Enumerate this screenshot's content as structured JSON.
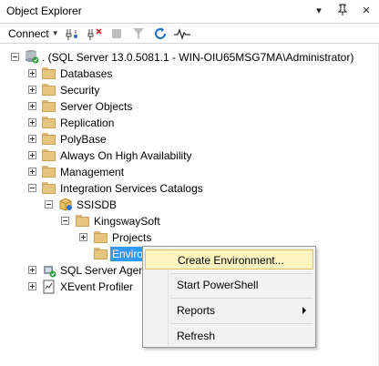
{
  "window": {
    "title": "Object Explorer"
  },
  "toolbar": {
    "connect_label": "Connect"
  },
  "tree": {
    "root": ". (SQL Server 13.0.5081.1 - WIN-OIU65MSG7MA\\Administrator)",
    "databases": "Databases",
    "security": "Security",
    "server_objects": "Server Objects",
    "replication": "Replication",
    "polybase": "PolyBase",
    "always_on": "Always On High Availability",
    "management": "Management",
    "integration_services_catalogs": "Integration Services Catalogs",
    "ssisdb": "SSISDB",
    "kingswaysoft": "KingswaySoft",
    "projects": "Projects",
    "environments": "Enviro",
    "sql_server_agent": "SQL Server Agent",
    "xevent_profiler": "XEvent Profiler"
  },
  "context_menu": {
    "create_environment": "Create Environment...",
    "start_powershell": "Start PowerShell",
    "reports": "Reports",
    "refresh": "Refresh"
  },
  "colors": {
    "selection": "#3399ff",
    "menu_highlight": "#fdf4bf",
    "folder": "#e8c57e"
  }
}
